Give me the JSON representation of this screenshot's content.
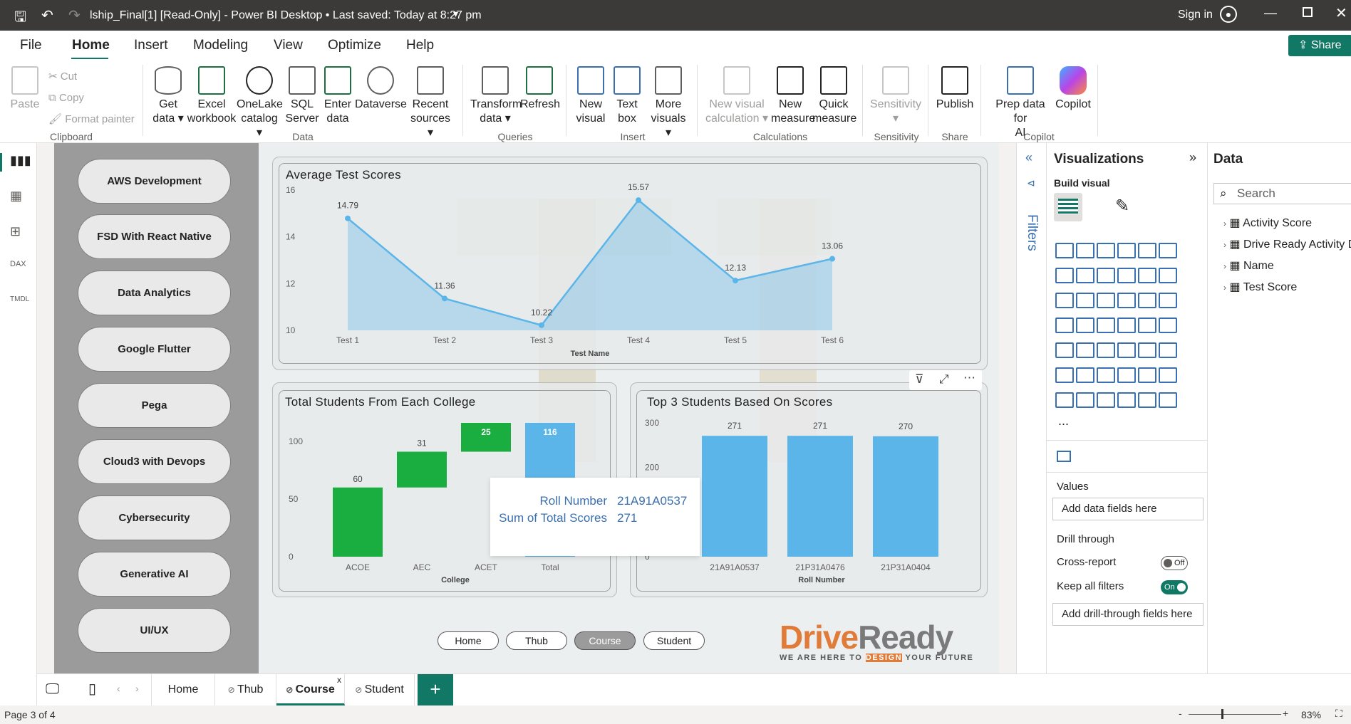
{
  "titlebar": {
    "title": "lship_Final[1] [Read-Only] - Power BI Desktop • Last saved: Today at 8:27 pm",
    "sign_in": "Sign in"
  },
  "menu": {
    "items": [
      "File",
      "Home",
      "Insert",
      "Modeling",
      "View",
      "Optimize",
      "Help"
    ],
    "share": "Share"
  },
  "ribbon": {
    "paste": "Paste",
    "cut": "Cut",
    "copy": "Copy",
    "format_painter": "Format painter",
    "clipboard": "Clipboard",
    "data_group": "Data",
    "queries": "Queries",
    "insert": "Insert",
    "calculations": "Calculations",
    "sensitivity_group": "Sensitivity",
    "share_group": "Share",
    "copilot": "Copilot",
    "get_data": [
      "Get",
      "data"
    ],
    "excel": [
      "Excel",
      "workbook"
    ],
    "onelake": [
      "OneLake",
      "catalog"
    ],
    "sql": [
      "SQL",
      "Server"
    ],
    "enter_data": [
      "Enter",
      "data"
    ],
    "dataverse": [
      "Dataverse"
    ],
    "recent": [
      "Recent",
      "sources"
    ],
    "transform": [
      "Transform",
      "data"
    ],
    "refresh": [
      "Refresh"
    ],
    "new_visual": [
      "New",
      "visual"
    ],
    "text_box": [
      "Text",
      "box"
    ],
    "more_visuals": [
      "More",
      "visuals"
    ],
    "new_visual_calc": [
      "New visual",
      "calculation"
    ],
    "new_measure": [
      "New",
      "measure"
    ],
    "quick_measure": [
      "Quick",
      "measure"
    ],
    "sensitivity": [
      "Sensitivity"
    ],
    "publish": [
      "Publish"
    ],
    "prep_data": [
      "Prep data for",
      "AI"
    ],
    "copilot_btn": [
      "Copilot"
    ]
  },
  "courses": [
    "AWS Development",
    "FSD With React Native",
    "Data Analytics",
    "Google Flutter",
    "Pega",
    "Cloud3 with Devops",
    "Cybersecurity",
    "Generative AI",
    "UI/UX"
  ],
  "chart_titles": {
    "line": "Average Test Scores",
    "waterfall": "Total Students From Each College",
    "bar": "Top 3 Students Based On Scores"
  },
  "chart_data": [
    {
      "type": "area",
      "title": "Average Test Scores",
      "xlabel": "Test Name",
      "ylabel": "",
      "ylim": [
        10,
        16
      ],
      "yticks": [
        10,
        12,
        14,
        16
      ],
      "categories": [
        "Test 1",
        "Test 2",
        "Test 3",
        "Test 4",
        "Test 5",
        "Test 6"
      ],
      "values": [
        14.79,
        11.36,
        10.22,
        15.57,
        12.13,
        13.06
      ],
      "color": "#5bb5e8"
    },
    {
      "type": "bar",
      "subtype": "waterfall",
      "title": "Total Students From Each College",
      "xlabel": "College",
      "ylabel": "",
      "ylim": [
        0,
        116
      ],
      "yticks": [
        0,
        50,
        100
      ],
      "categories": [
        "ACOE",
        "AEC",
        "ACET",
        "Total"
      ],
      "values": [
        60,
        31,
        25,
        116
      ],
      "colors": {
        "increase": "#1aad3f",
        "total": "#5bb5e8"
      }
    },
    {
      "type": "bar",
      "title": "Top 3 Students Based On Scores",
      "xlabel": "Roll Number",
      "ylabel": "",
      "ylim": [
        0,
        300
      ],
      "yticks": [
        0,
        200,
        300
      ],
      "categories": [
        "21A91A0537",
        "21P31A0476",
        "21P31A0404"
      ],
      "values": [
        271,
        271,
        270
      ],
      "color": "#5bb5e8"
    }
  ],
  "tooltip": {
    "label1": "Roll Number",
    "value1": "21A91A0537",
    "label2": "Sum of Total Scores",
    "value2": "271"
  },
  "nav": [
    "Home",
    "Thub",
    "Course",
    "Student"
  ],
  "logo": {
    "brand1": "Drive",
    "brand2": "Ready",
    "tagline1": "WE ARE HERE TO ",
    "tagline2": "DESIGN",
    "tagline3": " YOUR FUTURE"
  },
  "filters_label": "Filters",
  "viz": {
    "title": "Visualizations",
    "build": "Build visual",
    "values": "Values",
    "add_fields": "Add data fields here",
    "drill": "Drill through",
    "cross": "Cross-report",
    "cross_state": "Off",
    "keep": "Keep all filters",
    "keep_state": "On",
    "add_drill": "Add drill-through fields here",
    "more": "..."
  },
  "data_pane": {
    "title": "Data",
    "search": "Search",
    "tables": [
      "Activity Score",
      "Drive Ready Activity D",
      "Name",
      "Test Score"
    ]
  },
  "tabs": [
    "Home",
    "Thub",
    "Course",
    "Student"
  ],
  "status": {
    "page": "Page 3 of 4",
    "zoom": "83%"
  }
}
